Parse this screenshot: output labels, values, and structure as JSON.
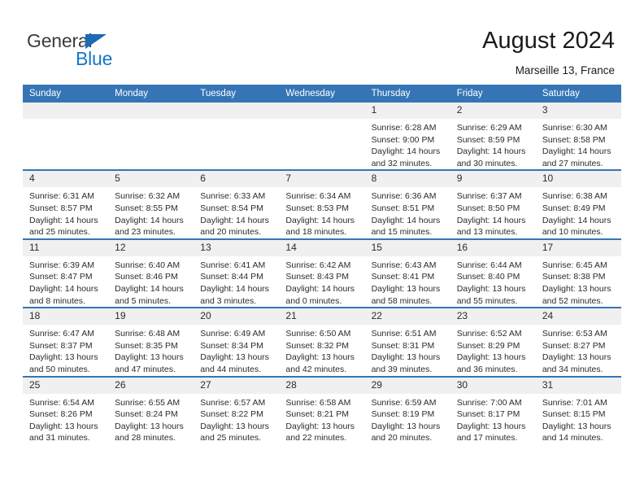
{
  "brand": {
    "name_top": "General",
    "name_bottom": "Blue",
    "triangle_color": "#1d6bb5",
    "blue_text_color": "#1576c6"
  },
  "header": {
    "title": "August 2024",
    "subtitle": "Marseille 13, France"
  },
  "theme": {
    "header_row_bg": "#3575b6",
    "daynum_bg": "#f0f0f0",
    "row_divider": "#3575b6",
    "text": "#2b2b2b"
  },
  "weekday_headers": [
    "Sunday",
    "Monday",
    "Tuesday",
    "Wednesday",
    "Thursday",
    "Friday",
    "Saturday"
  ],
  "weeks": [
    [
      {
        "day": "",
        "empty": true
      },
      {
        "day": "",
        "empty": true
      },
      {
        "day": "",
        "empty": true
      },
      {
        "day": "",
        "empty": true
      },
      {
        "day": "1",
        "sunrise": "Sunrise: 6:28 AM",
        "sunset": "Sunset: 9:00 PM",
        "daylight1": "Daylight: 14 hours",
        "daylight2": "and 32 minutes."
      },
      {
        "day": "2",
        "sunrise": "Sunrise: 6:29 AM",
        "sunset": "Sunset: 8:59 PM",
        "daylight1": "Daylight: 14 hours",
        "daylight2": "and 30 minutes."
      },
      {
        "day": "3",
        "sunrise": "Sunrise: 6:30 AM",
        "sunset": "Sunset: 8:58 PM",
        "daylight1": "Daylight: 14 hours",
        "daylight2": "and 27 minutes."
      }
    ],
    [
      {
        "day": "4",
        "sunrise": "Sunrise: 6:31 AM",
        "sunset": "Sunset: 8:57 PM",
        "daylight1": "Daylight: 14 hours",
        "daylight2": "and 25 minutes."
      },
      {
        "day": "5",
        "sunrise": "Sunrise: 6:32 AM",
        "sunset": "Sunset: 8:55 PM",
        "daylight1": "Daylight: 14 hours",
        "daylight2": "and 23 minutes."
      },
      {
        "day": "6",
        "sunrise": "Sunrise: 6:33 AM",
        "sunset": "Sunset: 8:54 PM",
        "daylight1": "Daylight: 14 hours",
        "daylight2": "and 20 minutes."
      },
      {
        "day": "7",
        "sunrise": "Sunrise: 6:34 AM",
        "sunset": "Sunset: 8:53 PM",
        "daylight1": "Daylight: 14 hours",
        "daylight2": "and 18 minutes."
      },
      {
        "day": "8",
        "sunrise": "Sunrise: 6:36 AM",
        "sunset": "Sunset: 8:51 PM",
        "daylight1": "Daylight: 14 hours",
        "daylight2": "and 15 minutes."
      },
      {
        "day": "9",
        "sunrise": "Sunrise: 6:37 AM",
        "sunset": "Sunset: 8:50 PM",
        "daylight1": "Daylight: 14 hours",
        "daylight2": "and 13 minutes."
      },
      {
        "day": "10",
        "sunrise": "Sunrise: 6:38 AM",
        "sunset": "Sunset: 8:49 PM",
        "daylight1": "Daylight: 14 hours",
        "daylight2": "and 10 minutes."
      }
    ],
    [
      {
        "day": "11",
        "sunrise": "Sunrise: 6:39 AM",
        "sunset": "Sunset: 8:47 PM",
        "daylight1": "Daylight: 14 hours",
        "daylight2": "and 8 minutes."
      },
      {
        "day": "12",
        "sunrise": "Sunrise: 6:40 AM",
        "sunset": "Sunset: 8:46 PM",
        "daylight1": "Daylight: 14 hours",
        "daylight2": "and 5 minutes."
      },
      {
        "day": "13",
        "sunrise": "Sunrise: 6:41 AM",
        "sunset": "Sunset: 8:44 PM",
        "daylight1": "Daylight: 14 hours",
        "daylight2": "and 3 minutes."
      },
      {
        "day": "14",
        "sunrise": "Sunrise: 6:42 AM",
        "sunset": "Sunset: 8:43 PM",
        "daylight1": "Daylight: 14 hours",
        "daylight2": "and 0 minutes."
      },
      {
        "day": "15",
        "sunrise": "Sunrise: 6:43 AM",
        "sunset": "Sunset: 8:41 PM",
        "daylight1": "Daylight: 13 hours",
        "daylight2": "and 58 minutes."
      },
      {
        "day": "16",
        "sunrise": "Sunrise: 6:44 AM",
        "sunset": "Sunset: 8:40 PM",
        "daylight1": "Daylight: 13 hours",
        "daylight2": "and 55 minutes."
      },
      {
        "day": "17",
        "sunrise": "Sunrise: 6:45 AM",
        "sunset": "Sunset: 8:38 PM",
        "daylight1": "Daylight: 13 hours",
        "daylight2": "and 52 minutes."
      }
    ],
    [
      {
        "day": "18",
        "sunrise": "Sunrise: 6:47 AM",
        "sunset": "Sunset: 8:37 PM",
        "daylight1": "Daylight: 13 hours",
        "daylight2": "and 50 minutes."
      },
      {
        "day": "19",
        "sunrise": "Sunrise: 6:48 AM",
        "sunset": "Sunset: 8:35 PM",
        "daylight1": "Daylight: 13 hours",
        "daylight2": "and 47 minutes."
      },
      {
        "day": "20",
        "sunrise": "Sunrise: 6:49 AM",
        "sunset": "Sunset: 8:34 PM",
        "daylight1": "Daylight: 13 hours",
        "daylight2": "and 44 minutes."
      },
      {
        "day": "21",
        "sunrise": "Sunrise: 6:50 AM",
        "sunset": "Sunset: 8:32 PM",
        "daylight1": "Daylight: 13 hours",
        "daylight2": "and 42 minutes."
      },
      {
        "day": "22",
        "sunrise": "Sunrise: 6:51 AM",
        "sunset": "Sunset: 8:31 PM",
        "daylight1": "Daylight: 13 hours",
        "daylight2": "and 39 minutes."
      },
      {
        "day": "23",
        "sunrise": "Sunrise: 6:52 AM",
        "sunset": "Sunset: 8:29 PM",
        "daylight1": "Daylight: 13 hours",
        "daylight2": "and 36 minutes."
      },
      {
        "day": "24",
        "sunrise": "Sunrise: 6:53 AM",
        "sunset": "Sunset: 8:27 PM",
        "daylight1": "Daylight: 13 hours",
        "daylight2": "and 34 minutes."
      }
    ],
    [
      {
        "day": "25",
        "sunrise": "Sunrise: 6:54 AM",
        "sunset": "Sunset: 8:26 PM",
        "daylight1": "Daylight: 13 hours",
        "daylight2": "and 31 minutes."
      },
      {
        "day": "26",
        "sunrise": "Sunrise: 6:55 AM",
        "sunset": "Sunset: 8:24 PM",
        "daylight1": "Daylight: 13 hours",
        "daylight2": "and 28 minutes."
      },
      {
        "day": "27",
        "sunrise": "Sunrise: 6:57 AM",
        "sunset": "Sunset: 8:22 PM",
        "daylight1": "Daylight: 13 hours",
        "daylight2": "and 25 minutes."
      },
      {
        "day": "28",
        "sunrise": "Sunrise: 6:58 AM",
        "sunset": "Sunset: 8:21 PM",
        "daylight1": "Daylight: 13 hours",
        "daylight2": "and 22 minutes."
      },
      {
        "day": "29",
        "sunrise": "Sunrise: 6:59 AM",
        "sunset": "Sunset: 8:19 PM",
        "daylight1": "Daylight: 13 hours",
        "daylight2": "and 20 minutes."
      },
      {
        "day": "30",
        "sunrise": "Sunrise: 7:00 AM",
        "sunset": "Sunset: 8:17 PM",
        "daylight1": "Daylight: 13 hours",
        "daylight2": "and 17 minutes."
      },
      {
        "day": "31",
        "sunrise": "Sunrise: 7:01 AM",
        "sunset": "Sunset: 8:15 PM",
        "daylight1": "Daylight: 13 hours",
        "daylight2": "and 14 minutes."
      }
    ]
  ]
}
